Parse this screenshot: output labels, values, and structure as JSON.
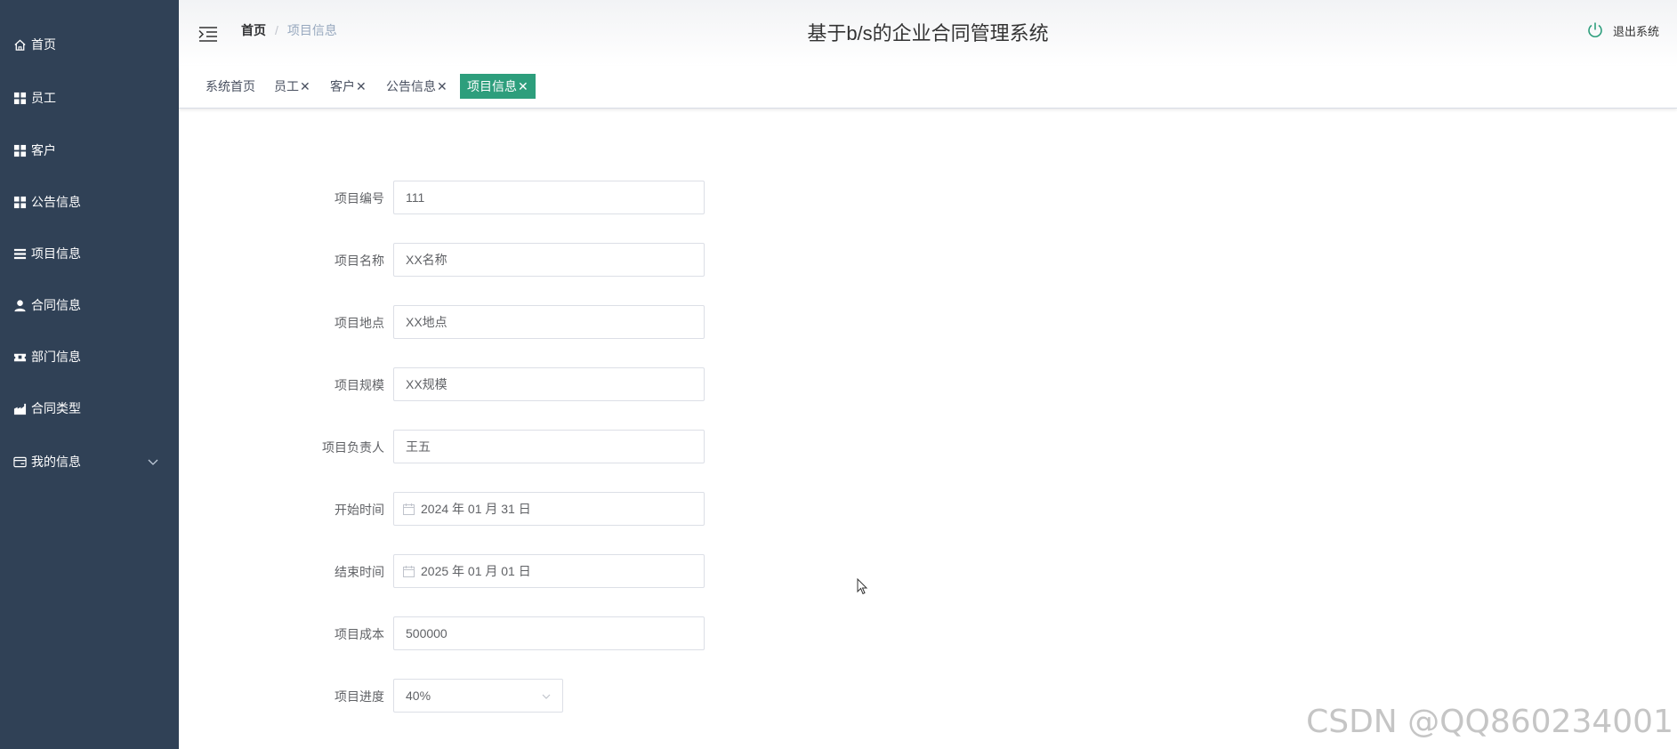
{
  "sidebar": {
    "items": [
      {
        "label": "首页",
        "icon": "home-icon"
      },
      {
        "label": "员工",
        "icon": "grid-icon"
      },
      {
        "label": "客户",
        "icon": "grid-icon"
      },
      {
        "label": "公告信息",
        "icon": "grid-icon"
      },
      {
        "label": "项目信息",
        "icon": "list-icon"
      },
      {
        "label": "合同信息",
        "icon": "user-icon"
      },
      {
        "label": "部门信息",
        "icon": "ticket-icon"
      },
      {
        "label": "合同类型",
        "icon": "factory-icon"
      },
      {
        "label": "我的信息",
        "icon": "card-icon",
        "expandable": true
      }
    ]
  },
  "header": {
    "breadcrumb_home": "首页",
    "breadcrumb_sep": "/",
    "breadcrumb_current": "项目信息",
    "title": "基于b/s的企业合同管理系统",
    "logout_label": "退出系统"
  },
  "tags": [
    {
      "label": "系统首页",
      "closable": false
    },
    {
      "label": "员工",
      "closable": true
    },
    {
      "label": "客户",
      "closable": true
    },
    {
      "label": "公告信息",
      "closable": true
    },
    {
      "label": "项目信息",
      "closable": true,
      "active": true
    }
  ],
  "tag_close": "✕",
  "form": {
    "project_no": {
      "label": "项目编号",
      "value": "111"
    },
    "project_name": {
      "label": "项目名称",
      "value": "XX名称"
    },
    "project_location": {
      "label": "项目地点",
      "value": "XX地点"
    },
    "project_scale": {
      "label": "项目规模",
      "value": "XX规模"
    },
    "project_manager": {
      "label": "项目负责人",
      "value": "王五"
    },
    "start_time": {
      "label": "开始时间",
      "value": "2024 年 01 月 31 日"
    },
    "end_time": {
      "label": "结束时间",
      "value": "2025 年 01 月 01 日"
    },
    "project_cost": {
      "label": "项目成本",
      "value": "500000"
    },
    "project_progress": {
      "label": "项目进度",
      "value": "40%"
    }
  },
  "colors": {
    "sidebar_bg": "#304156",
    "active_tag": "#2d9e7c",
    "logout_icon": "#2d9e7c"
  },
  "watermark": "CSDN @QQ860234001"
}
